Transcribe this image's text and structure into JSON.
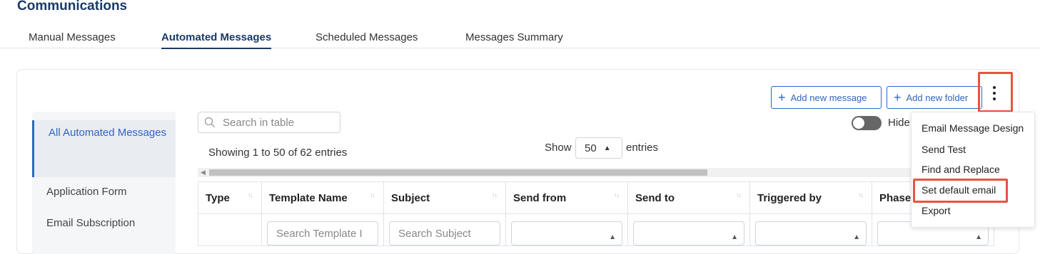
{
  "page": {
    "title": "Communications"
  },
  "tabs": [
    {
      "label": "Manual Messages",
      "active": false
    },
    {
      "label": "Automated Messages",
      "active": true
    },
    {
      "label": "Scheduled Messages",
      "active": false
    },
    {
      "label": "Messages Summary",
      "active": false
    }
  ],
  "toolbar": {
    "add_message_label": "Add new message",
    "add_folder_label": "Add new folder",
    "more_icon": "kebab-vertical-icon"
  },
  "sidebar": {
    "items": [
      {
        "label": "All Automated Messages",
        "active": true
      },
      {
        "label": "Application Form",
        "active": false
      },
      {
        "label": "Email Subscription",
        "active": false
      }
    ]
  },
  "search": {
    "placeholder": "Search in table",
    "icon": "search-icon"
  },
  "table_info": {
    "showing": "Showing 1 to 50 of 62 entries",
    "show_label": "Show",
    "entries_value": "50",
    "entries_label": "entries",
    "hide_label": "Hide"
  },
  "table": {
    "columns": [
      "Type",
      "Template Name",
      "Subject",
      "Send from",
      "Send to",
      "Triggered by",
      "Phase"
    ],
    "filters": {
      "template_name_placeholder": "Search Template I",
      "subject_placeholder": "Search Subject"
    }
  },
  "menu": {
    "items": [
      "Email Message Design",
      "Send Test",
      "Find and Replace",
      "Set default email",
      "Export"
    ],
    "highlighted_index": 3
  },
  "colors": {
    "primary": "#2f66c1",
    "title": "#1a3a66",
    "highlight": "#e8543f"
  }
}
